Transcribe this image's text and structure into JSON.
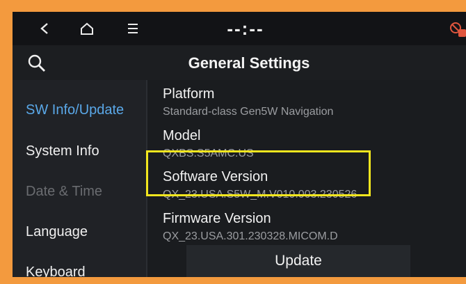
{
  "statusbar": {
    "clock": "--:--",
    "back_icon": "chevron-left-icon",
    "home_icon": "home-icon",
    "menu_icon": "menu-icon",
    "status_icon": "do-not-disturb-icon"
  },
  "header": {
    "title": "General Settings",
    "search_icon": "search-icon"
  },
  "sidebar": {
    "items": [
      {
        "label": "SW Info/Update",
        "state": "active"
      },
      {
        "label": "System Info",
        "state": "normal"
      },
      {
        "label": "Date & Time",
        "state": "disabled"
      },
      {
        "label": "Language",
        "state": "normal"
      },
      {
        "label": "Keyboard",
        "state": "normal"
      }
    ]
  },
  "content": {
    "rows": [
      {
        "title": "Platform",
        "value": "Standard-class Gen5W Navigation"
      },
      {
        "title": "Model",
        "value": "QXBS.S5AMC.US"
      },
      {
        "title": "Software Version",
        "value": "QX_23.USA.S5W_M.V010.003.230526"
      },
      {
        "title": "Firmware Version",
        "value": "QX_23.USA.301.230328.MICOM.D"
      }
    ],
    "update_label": "Update"
  },
  "colors": {
    "frame": "#f39a3e",
    "active": "#5aa8e8",
    "highlight": "#f2e61e",
    "status_icon": "#e0563e"
  }
}
